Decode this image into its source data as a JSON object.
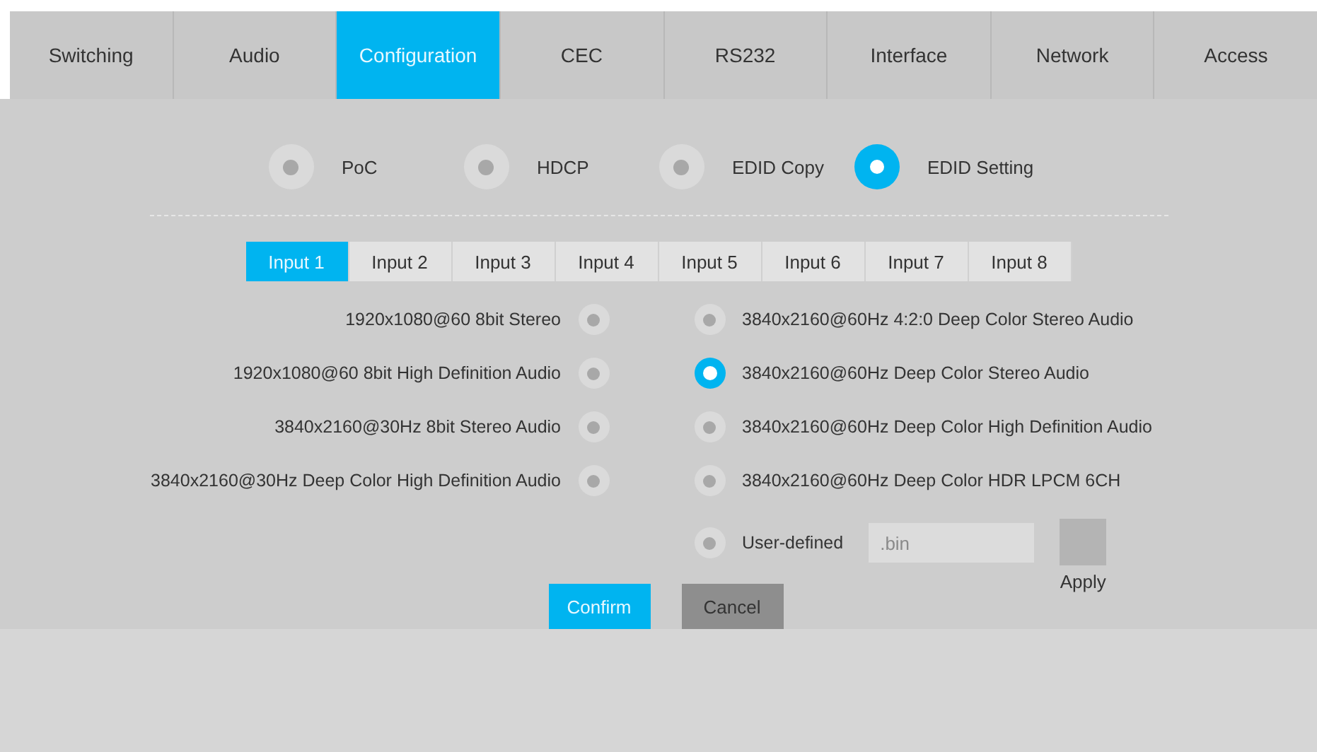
{
  "tabs": [
    {
      "label": "Switching",
      "selected": false
    },
    {
      "label": "Audio",
      "selected": false
    },
    {
      "label": "Configuration",
      "selected": true
    },
    {
      "label": "CEC",
      "selected": false
    },
    {
      "label": "RS232",
      "selected": false
    },
    {
      "label": "Interface",
      "selected": false
    },
    {
      "label": "Network",
      "selected": false
    },
    {
      "label": "Access",
      "selected": false
    }
  ],
  "modes": [
    {
      "label": "PoC",
      "selected": false
    },
    {
      "label": "HDCP",
      "selected": false
    },
    {
      "label": "EDID Copy",
      "selected": false
    },
    {
      "label": "EDID Setting",
      "selected": true
    }
  ],
  "input_tabs": [
    {
      "label": "Input 1",
      "selected": true
    },
    {
      "label": "Input 2",
      "selected": false
    },
    {
      "label": "Input 3",
      "selected": false
    },
    {
      "label": "Input 4",
      "selected": false
    },
    {
      "label": "Input 5",
      "selected": false
    },
    {
      "label": "Input 6",
      "selected": false
    },
    {
      "label": "Input 7",
      "selected": false
    },
    {
      "label": "Input 8",
      "selected": false
    }
  ],
  "edid_left": [
    {
      "label": "1920x1080@60 8bit Stereo",
      "selected": false
    },
    {
      "label": "1920x1080@60 8bit High Definition Audio",
      "selected": false
    },
    {
      "label": "3840x2160@30Hz 8bit Stereo Audio",
      "selected": false
    },
    {
      "label": "3840x2160@30Hz Deep Color High Definition Audio",
      "selected": false
    }
  ],
  "edid_right": [
    {
      "label": "3840x2160@60Hz 4:2:0 Deep Color Stereo Audio",
      "selected": false
    },
    {
      "label": "3840x2160@60Hz Deep Color Stereo Audio",
      "selected": true
    },
    {
      "label": "3840x2160@60Hz Deep Color High Definition Audio",
      "selected": false
    },
    {
      "label": "3840x2160@60Hz Deep Color HDR LPCM 6CH",
      "selected": false
    }
  ],
  "user_defined": {
    "label": "User-defined",
    "selected": false,
    "placeholder": ".bin",
    "apply": "Apply"
  },
  "buttons": [
    {
      "label": "Confirm",
      "kind": "primary"
    },
    {
      "label": "Cancel",
      "kind": "secondary"
    }
  ]
}
